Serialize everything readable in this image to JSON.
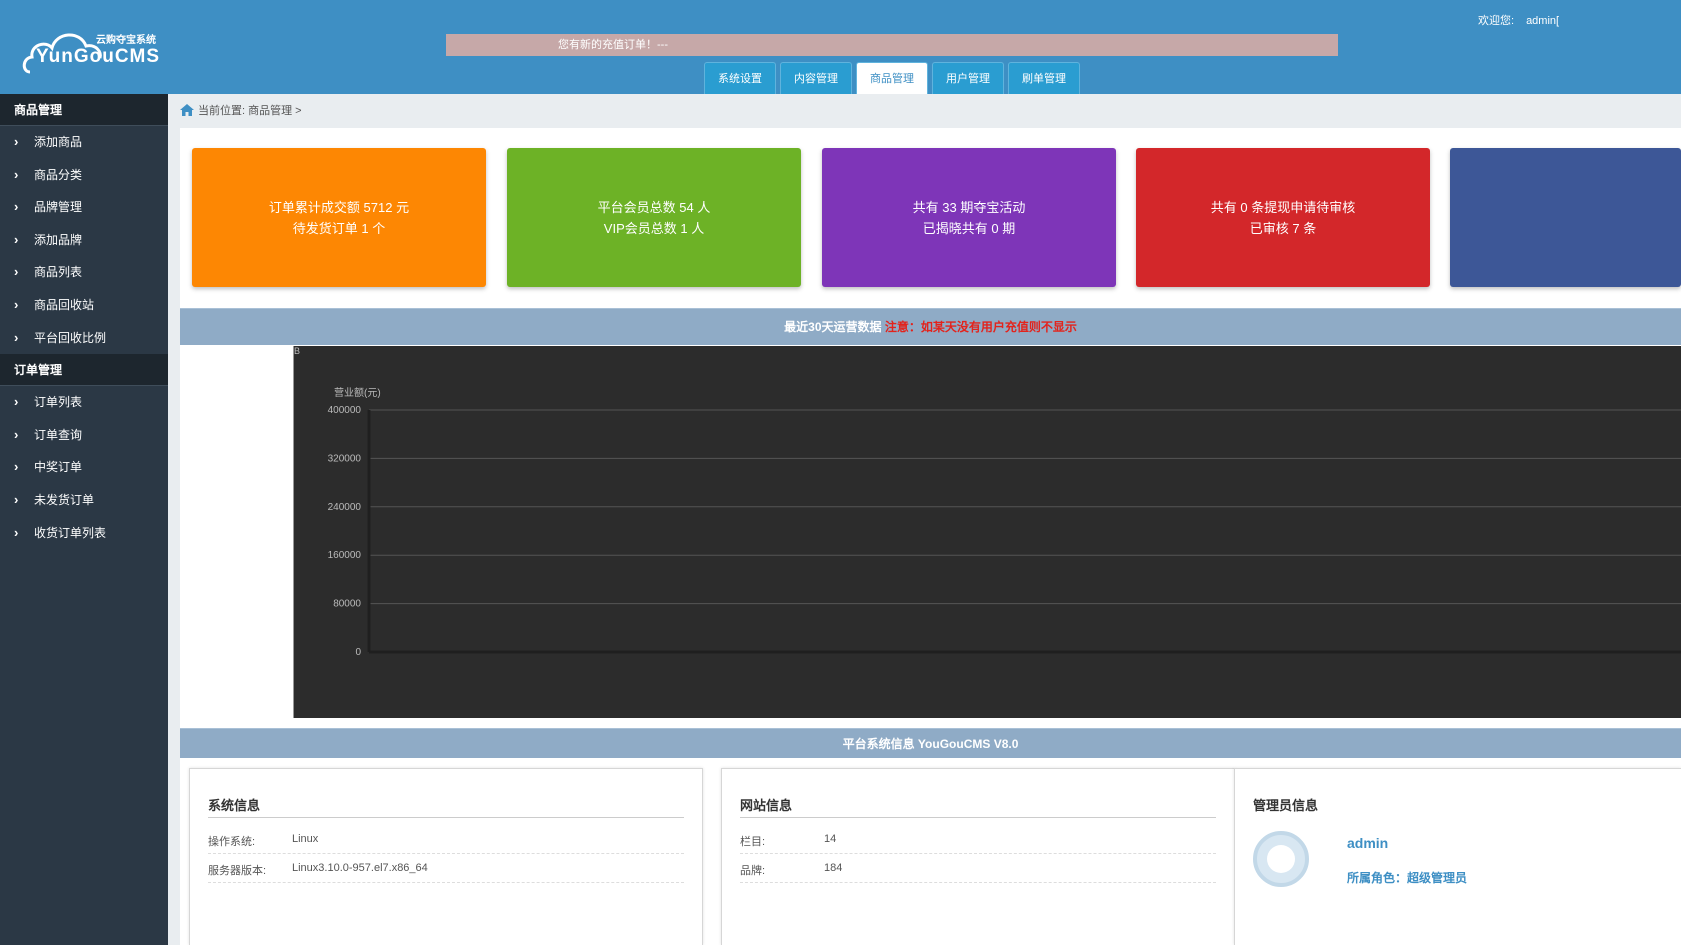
{
  "header": {
    "logo_sub": "云购夺宝系统",
    "logo_main": "YunGouCMS",
    "notice": "您有新的充值订单！---",
    "welcome_label": "欢迎您:",
    "welcome_user": "admin[",
    "tabs": [
      {
        "label": "系统设置",
        "active": false
      },
      {
        "label": "内容管理",
        "active": false
      },
      {
        "label": "商品管理",
        "active": true
      },
      {
        "label": "用户管理",
        "active": false
      },
      {
        "label": "刷单管理",
        "active": false
      }
    ]
  },
  "sidebar": {
    "groups": [
      {
        "title": "商品管理",
        "items": [
          "添加商品",
          "商品分类",
          "品牌管理",
          "添加品牌",
          "商品列表",
          "商品回收站",
          "平台回收比例"
        ]
      },
      {
        "title": "订单管理",
        "items": [
          "订单列表",
          "订单查询",
          "中奖订单",
          "未发货订单",
          "收货订单列表"
        ]
      }
    ]
  },
  "breadcrumb": {
    "text": "当前位置: 商品管理 >"
  },
  "cards": [
    {
      "line1": "订单累计成交额 5712 元",
      "line2": "待发货订单 1 个",
      "color": "#fd8703"
    },
    {
      "line1": "平台会员总数 54 人",
      "line2": "VIP会员总数 1 人",
      "color": "#6db226"
    },
    {
      "line1": "共有 33 期夺宝活动",
      "line2": "已揭晓共有 0 期",
      "color": "#7e35b8"
    },
    {
      "line1": "共有 0 条提现申请待审核",
      "line2": "已审核 7 条",
      "color": "#d3272a"
    },
    {
      "line1": "",
      "line2": "",
      "color": "#3d5797"
    }
  ],
  "ops_section": {
    "title": "最近30天运营数据",
    "warning": "注意：如某天没有用户充值则不显示"
  },
  "chart_data": {
    "type": "line",
    "corner_label": "B",
    "ylabel": "营业额(元)",
    "ylim": [
      0,
      400000
    ],
    "yticks": [
      "400000",
      "320000",
      "240000",
      "160000",
      "80000",
      "0"
    ],
    "series": []
  },
  "sys_section": {
    "title": "平台系统信息 YouGouCMS V8.0"
  },
  "system_info": {
    "title": "系统信息",
    "rows": [
      {
        "k": "操作系统:",
        "v": "Linux"
      },
      {
        "k": "服务器版本:",
        "v": "Linux3.10.0-957.el7.x86_64"
      }
    ]
  },
  "site_info": {
    "title": "网站信息",
    "rows": [
      {
        "k": "栏目:",
        "v": "14"
      },
      {
        "k": "品牌:",
        "v": "184"
      }
    ]
  },
  "admin_info": {
    "title": "管理员信息",
    "name": "admin",
    "role": "所属角色：超级管理员"
  }
}
